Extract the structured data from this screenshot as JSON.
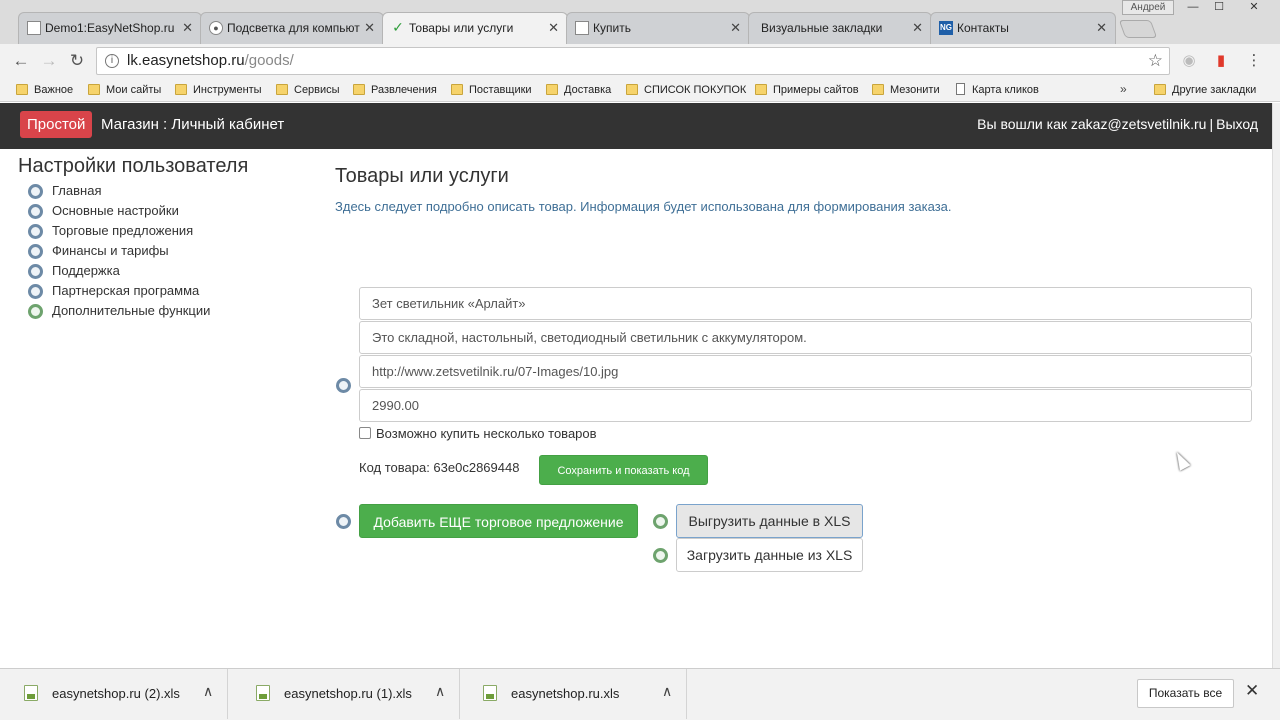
{
  "window": {
    "user_label": "Андрей",
    "minimize": "—",
    "maximize": "☐",
    "close": "✕"
  },
  "tabs": [
    {
      "label": "Demo1:EasyNetShop.ru",
      "icon": "page-icon",
      "close": "✕"
    },
    {
      "label": "Подсветка для компьют",
      "icon": "account-icon",
      "close": "✕"
    },
    {
      "label": "Товары или услуги",
      "icon": "check-icon",
      "close": "✕"
    },
    {
      "label": "Купить",
      "icon": "page-icon",
      "close": "✕"
    },
    {
      "label": "Визуальные закладки",
      "icon": "none",
      "close": "✕"
    },
    {
      "label": "Контакты",
      "icon": "NG",
      "close": "✕"
    }
  ],
  "nav": {
    "back": "←",
    "forward": "→",
    "reload": "↻"
  },
  "address": {
    "domain": "lk.easynetshop.ru",
    "path": "/goods/",
    "info_icon": "i",
    "star_icon": "☆"
  },
  "toolbar_icons": {
    "extension": "◉",
    "bookmark_flag": "▮",
    "menu": "⋮"
  },
  "bookmarks": [
    {
      "label": "Важное",
      "type": "folder"
    },
    {
      "label": "Мои сайты",
      "type": "folder"
    },
    {
      "label": "Инструменты",
      "type": "folder"
    },
    {
      "label": "Сервисы",
      "type": "folder"
    },
    {
      "label": "Развлечения",
      "type": "folder"
    },
    {
      "label": "Поставщики",
      "type": "folder"
    },
    {
      "label": "Доставка",
      "type": "folder"
    },
    {
      "label": "СПИСОК ПОКУПОК",
      "type": "folder"
    },
    {
      "label": "Примеры сайтов",
      "type": "folder"
    },
    {
      "label": "Мезонити",
      "type": "folder"
    },
    {
      "label": "Карта кликов",
      "type": "page"
    }
  ],
  "bookmarks_more": "»",
  "other_bookmarks": "Другие закладки",
  "header": {
    "brand_badge": "Простой",
    "brand_title": "Магазин : Личный кабинет",
    "login_text": "Вы вошли как zakaz@zetsvetilnik.ru",
    "separator": "|",
    "logout": "Выход"
  },
  "sidebar": {
    "title": "Настройки пользователя",
    "items": [
      {
        "label": "Главная",
        "ring": "blue"
      },
      {
        "label": "Основные настройки",
        "ring": "blue"
      },
      {
        "label": "Торговые предложения",
        "ring": "blue"
      },
      {
        "label": "Финансы и тарифы",
        "ring": "blue"
      },
      {
        "label": "Поддержка",
        "ring": "blue"
      },
      {
        "label": "Партнерская программа",
        "ring": "blue"
      },
      {
        "label": "Дополнительные функции",
        "ring": "green"
      }
    ]
  },
  "main": {
    "title": "Товары или услуги",
    "description": "Здесь следует подробно описать товар. Информация будет использована для формирования заказа.",
    "product_name": "Зет светильник «Арлайт»",
    "product_description": "Это складной, настольный, светодиодный светильник с аккумулятором.",
    "image_url": "http://www.zetsvetilnik.ru/07-Images/10.jpg",
    "price": "2990.00",
    "multi_buy_label": "Возможно купить несколько товаров",
    "code_label": "Код товара: 63e0c2869448",
    "save_code_button": "Сохранить и показать код",
    "add_offer_button": "Добавить ЕЩЕ торговое предложение",
    "export_xls_button": "Выгрузить данные в XLS",
    "import_xls_button": "Загрузить данные из XLS"
  },
  "downloads": {
    "items": [
      {
        "name": "easynetshop.ru (2).xls",
        "chevron": "∧"
      },
      {
        "name": "easynetshop.ru (1).xls",
        "chevron": "∧"
      },
      {
        "name": "easynetshop.ru.xls",
        "chevron": "∧"
      }
    ],
    "show_all": "Показать все",
    "close": "✕"
  }
}
